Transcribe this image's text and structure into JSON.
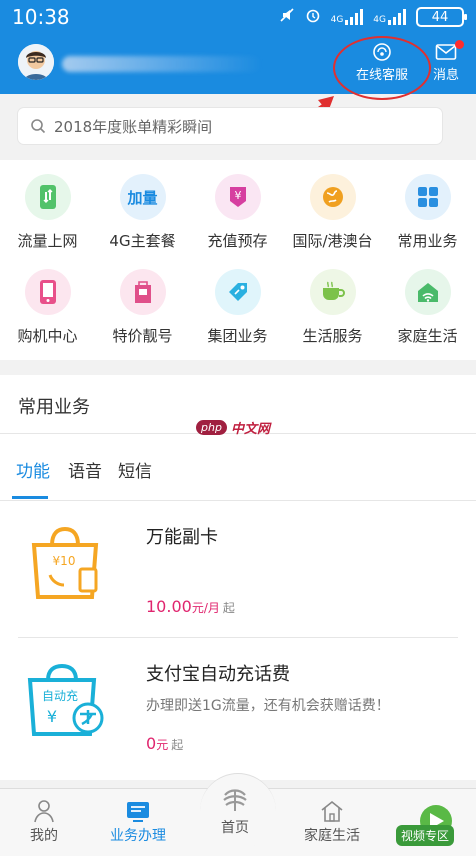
{
  "status_bar": {
    "time": "10:38",
    "network": "4G",
    "battery": "44"
  },
  "header": {
    "customer_service_label": "在线客服",
    "messages_label": "消息"
  },
  "search": {
    "placeholder": "2018年度账单精彩瞬间"
  },
  "grid": {
    "items": [
      {
        "label": "流量上网",
        "icon": "phone-data-icon",
        "color": "#52c26a",
        "bg": "#e6f7ea"
      },
      {
        "label": "4G主套餐",
        "icon": "jialiang-text-icon",
        "color": "#1a8be0",
        "bg": "#e3f1fc",
        "icon_text": "加量"
      },
      {
        "label": "充值预存",
        "icon": "yuan-coin-icon",
        "color": "#d63fa0",
        "bg": "#fae6f3",
        "icon_text": "¥"
      },
      {
        "label": "国际/港澳台",
        "icon": "globe-icon",
        "color": "#f0a020",
        "bg": "#fdf1dc"
      },
      {
        "label": "常用业务",
        "icon": "grid-squares-icon",
        "color": "#2a8fe0",
        "bg": "#e3f1fc"
      },
      {
        "label": "购机中心",
        "icon": "mobile-phone-icon",
        "color": "#e8508a",
        "bg": "#fce6ef"
      },
      {
        "label": "特价靓号",
        "icon": "number-card-icon",
        "color": "#e0508a",
        "bg": "#fce6ef"
      },
      {
        "label": "集团业务",
        "icon": "tag-icon",
        "color": "#2ab0e0",
        "bg": "#e0f5fb"
      },
      {
        "label": "生活服务",
        "icon": "coffee-cup-icon",
        "color": "#7cc24a",
        "bg": "#eef7e6"
      },
      {
        "label": "家庭生活",
        "icon": "home-wifi-icon",
        "color": "#4aba6a",
        "bg": "#e6f6ea"
      }
    ]
  },
  "common": {
    "title": "常用业务",
    "tabs": [
      {
        "label": "功能"
      },
      {
        "label": "语音"
      },
      {
        "label": "短信"
      }
    ],
    "products": [
      {
        "title": "万能副卡",
        "desc": "",
        "price": "10.00",
        "unit": "元/月",
        "from": "起",
        "img_text": "¥10"
      },
      {
        "title": "支付宝自动充话费",
        "desc": "办理即送1G流量，还有机会获赠话费！",
        "price": "0",
        "unit": "元",
        "from": "起",
        "img_text": "自动充"
      }
    ]
  },
  "watermark": {
    "badge": "php",
    "text": "中文网"
  },
  "bottom_nav": {
    "items": [
      {
        "label": "我的"
      },
      {
        "label": "业务办理"
      },
      {
        "label": "首页"
      },
      {
        "label": "家庭生活"
      }
    ],
    "video_label": "视频专区"
  },
  "colors": {
    "brand": "#1a8be0",
    "price": "#e0256e"
  }
}
